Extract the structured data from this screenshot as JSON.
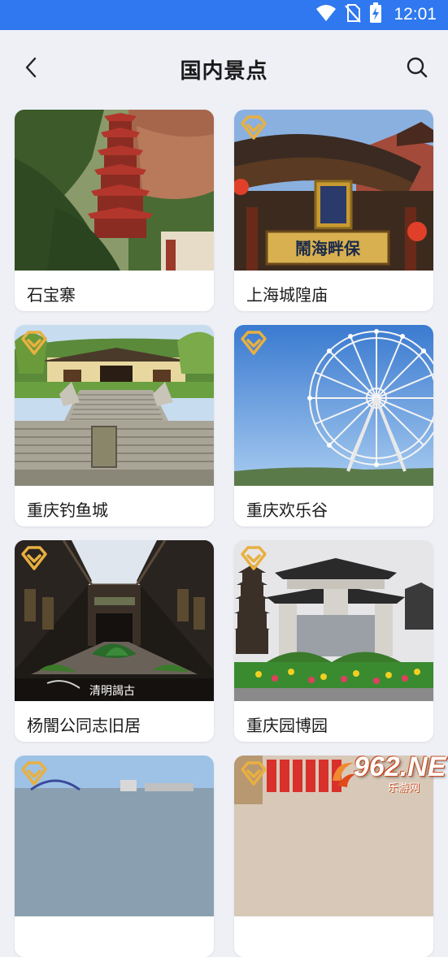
{
  "status_bar": {
    "time": "12:01",
    "icons": [
      "wifi-icon",
      "no-sim-icon",
      "battery-charging-icon"
    ]
  },
  "header": {
    "title": "国内景点",
    "back_icon": "chevron-left-icon",
    "search_icon": "search-icon"
  },
  "attractions": [
    {
      "name": "石宝寨",
      "favorite": false
    },
    {
      "name": "上海城隍庙",
      "favorite": true
    },
    {
      "name": "重庆钓鱼城",
      "favorite": true
    },
    {
      "name": "重庆欢乐谷",
      "favorite": true
    },
    {
      "name": "杨闇公同志旧居",
      "favorite": true
    },
    {
      "name": "重庆园博园",
      "favorite": true
    },
    {
      "name": "",
      "favorite": true
    },
    {
      "name": "",
      "favorite": true
    }
  ],
  "photo_captions": {
    "temple_plaque": "鬧海畔保",
    "courtyard_banner": "清明謁古"
  },
  "watermark": {
    "logo": "962.NET",
    "sub": "乐游网"
  },
  "colors": {
    "status_bar": "#2f78ef",
    "favorite_badge": "#e8b040",
    "background": "#eef0f6"
  }
}
